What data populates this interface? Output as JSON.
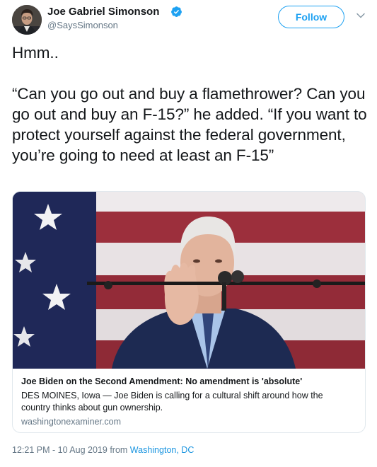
{
  "author": {
    "name": "Joe Gabriel Simonson",
    "handle": "@SaysSimonson",
    "verified_icon": "verified-badge-icon"
  },
  "actions": {
    "follow_label": "Follow",
    "more_icon": "chevron-down-icon"
  },
  "tweet": {
    "lines": [
      "Hmm..",
      "“Can you go out and buy a flamethrower? Can you go out and buy an F-15?” he added. “If you want to protect yourself against the federal government, you’re going to need at least an F-15”"
    ]
  },
  "card": {
    "title": "Joe Biden on the Second Amendment: No amendment is 'absolute'",
    "description": "DES MOINES, Iowa — Joe Biden is calling for a cultural shift around how the country thinks about gun ownership.",
    "domain": "washingtonexaminer.com"
  },
  "meta": {
    "timestamp": "12:21 PM - 10 Aug 2019",
    "from_label": "from",
    "location": "Washington, DC"
  },
  "colors": {
    "accent": "#1da1f2",
    "link": "#1b95e0",
    "secondary_text": "#657786",
    "border": "#e1e8ed"
  }
}
